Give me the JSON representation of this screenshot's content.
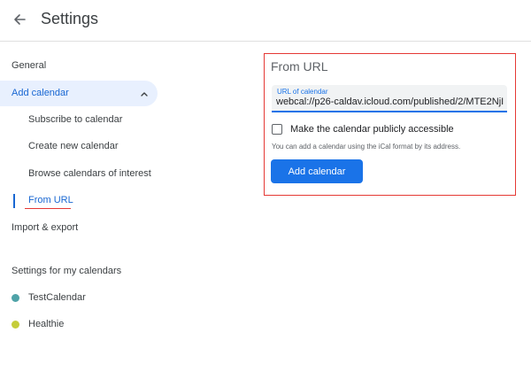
{
  "header": {
    "title": "Settings",
    "back_icon": "arrow-left-icon"
  },
  "sidebar": {
    "general": "General",
    "add_calendar": {
      "label": "Add calendar",
      "chevron_icon": "chevron-up-icon",
      "items": [
        {
          "label": "Subscribe to calendar"
        },
        {
          "label": "Create new calendar"
        },
        {
          "label": "Browse calendars of interest"
        },
        {
          "label": "From URL"
        }
      ]
    },
    "import_export": "Import & export",
    "my_calendars_heading": "Settings for my calendars",
    "calendars": [
      {
        "name": "TestCalendar",
        "color": "#4fa3a8"
      },
      {
        "name": "Healthie",
        "color": "#c5cd3a"
      }
    ]
  },
  "from_url": {
    "title": "From URL",
    "field_label": "URL of calendar",
    "field_value": "webcal://p26-caldav.icloud.com/published/2/MTE2NjI",
    "checkbox_label": "Make the calendar publicly accessible",
    "checkbox_checked": false,
    "helper_text": "You can add a calendar using the iCal format by its address.",
    "button_label": "Add calendar"
  },
  "colors": {
    "accent": "#1a73e8",
    "highlight": "#e53935",
    "selected_bg": "#e8f0fe"
  }
}
